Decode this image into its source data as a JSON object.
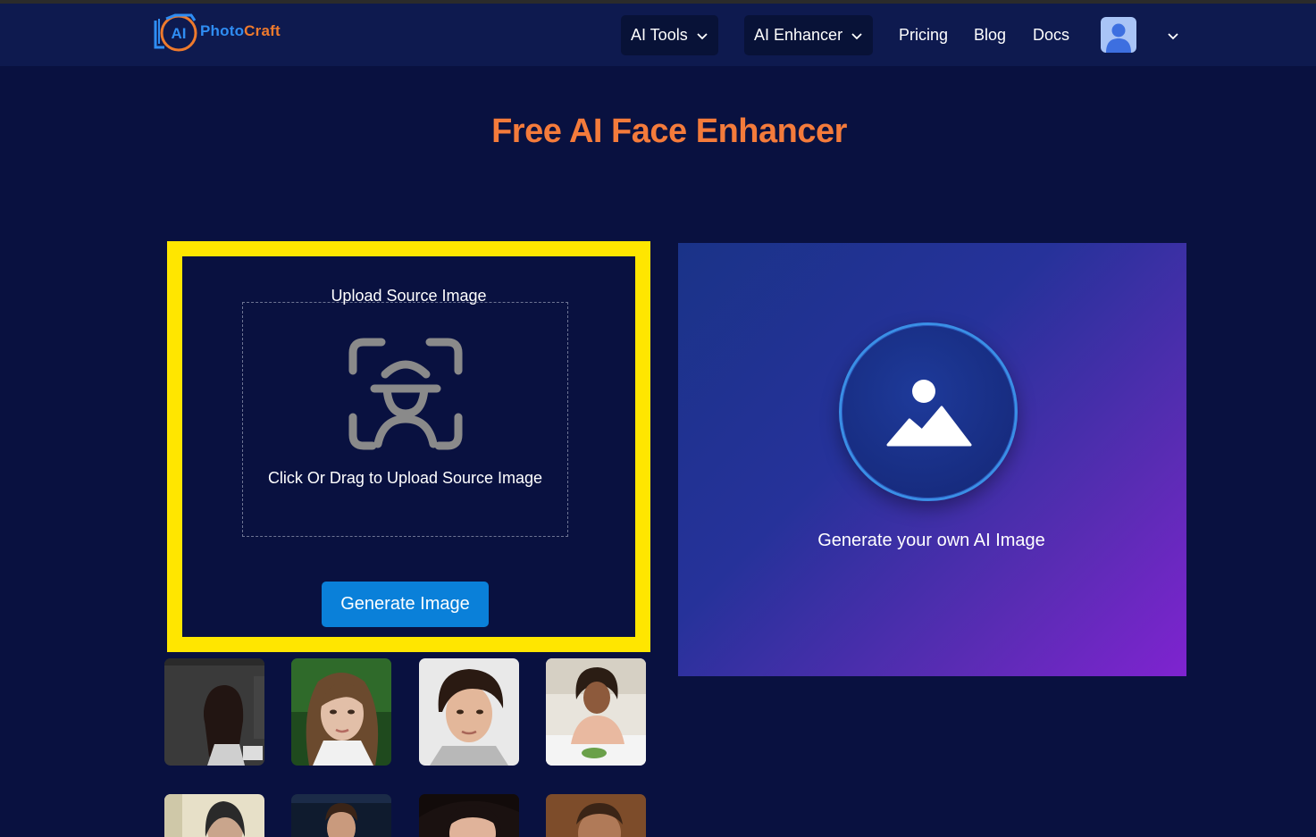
{
  "brand": {
    "logo_badge": "AI",
    "name_part1": "Photo",
    "name_part2": "Craft"
  },
  "nav": {
    "ai_tools": "AI Tools",
    "ai_enhancer": "AI Enhancer",
    "pricing": "Pricing",
    "blog": "Blog",
    "docs": "Docs"
  },
  "page": {
    "title": "Free AI Face Enhancer"
  },
  "upload": {
    "heading": "Upload Source Image",
    "dropzone_text": "Click Or Drag to Upload Source Image",
    "button_label": "Generate Image"
  },
  "preview": {
    "caption": "Generate your own AI Image"
  },
  "samples": {
    "count_visible": 8
  },
  "colors": {
    "background": "#091140",
    "header": "#0e1a4f",
    "title": "#f47b3b",
    "highlight_border": "#ffe600",
    "button": "#0a80d9",
    "logo_blue": "#2f8df3",
    "logo_orange": "#ee7a2d"
  },
  "icons": [
    "chevron-down-icon",
    "user-avatar-icon",
    "face-scan-icon",
    "image-placeholder-icon"
  ]
}
